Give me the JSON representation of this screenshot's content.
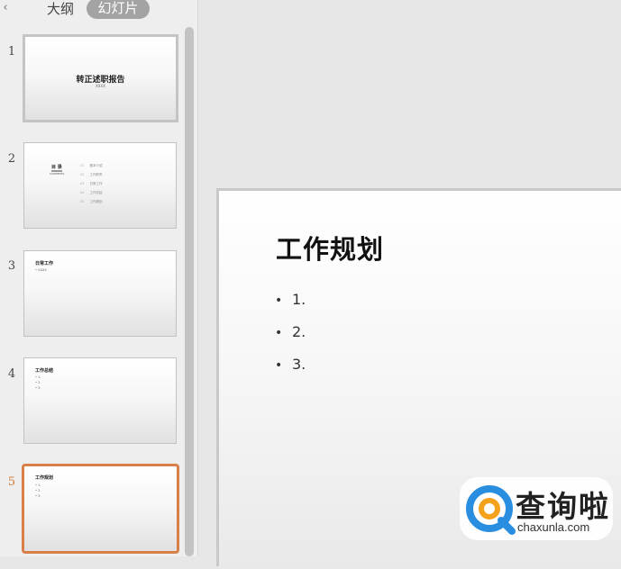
{
  "panel": {
    "tabs": {
      "outline": "大纲",
      "slides": "幻灯片"
    },
    "thumbnails": [
      {
        "number": "1",
        "title": "转正述职报告",
        "subtitle": "XXXX"
      },
      {
        "number": "2",
        "heading": "目 录",
        "heading_en": "CONTENTS",
        "items": [
          {
            "num": "01",
            "label": "基本介绍"
          },
          {
            "num": "02",
            "label": "工作职责"
          },
          {
            "num": "03",
            "label": "日常工作"
          },
          {
            "num": "04",
            "label": "工作总结"
          },
          {
            "num": "05",
            "label": "工作规划"
          }
        ]
      },
      {
        "number": "3",
        "title": "日常工作",
        "lines": [
          "• XXXX"
        ]
      },
      {
        "number": "4",
        "title": "工作总结",
        "lines": [
          "• 1.",
          "• 2.",
          "• 3."
        ]
      },
      {
        "number": "5",
        "title": "工作规划",
        "lines": [
          "• 1.",
          "• 2.",
          "• 3."
        ]
      }
    ],
    "active_slide": 5
  },
  "slide": {
    "title": "工作规划",
    "bullets": [
      "1.",
      "2.",
      "3."
    ],
    "bullet_char": "•"
  },
  "watermark": {
    "text_cn": "查询啦",
    "text_en": "chaxunla.com",
    "colors": {
      "ring_blue": "#2a8ee0",
      "ring_orange": "#f4a21c"
    }
  },
  "colors": {
    "active_accent": "#d9804a",
    "tab_active_bg": "#a3a3a3"
  },
  "icons": {
    "collapse": "chevron-left-icon"
  }
}
